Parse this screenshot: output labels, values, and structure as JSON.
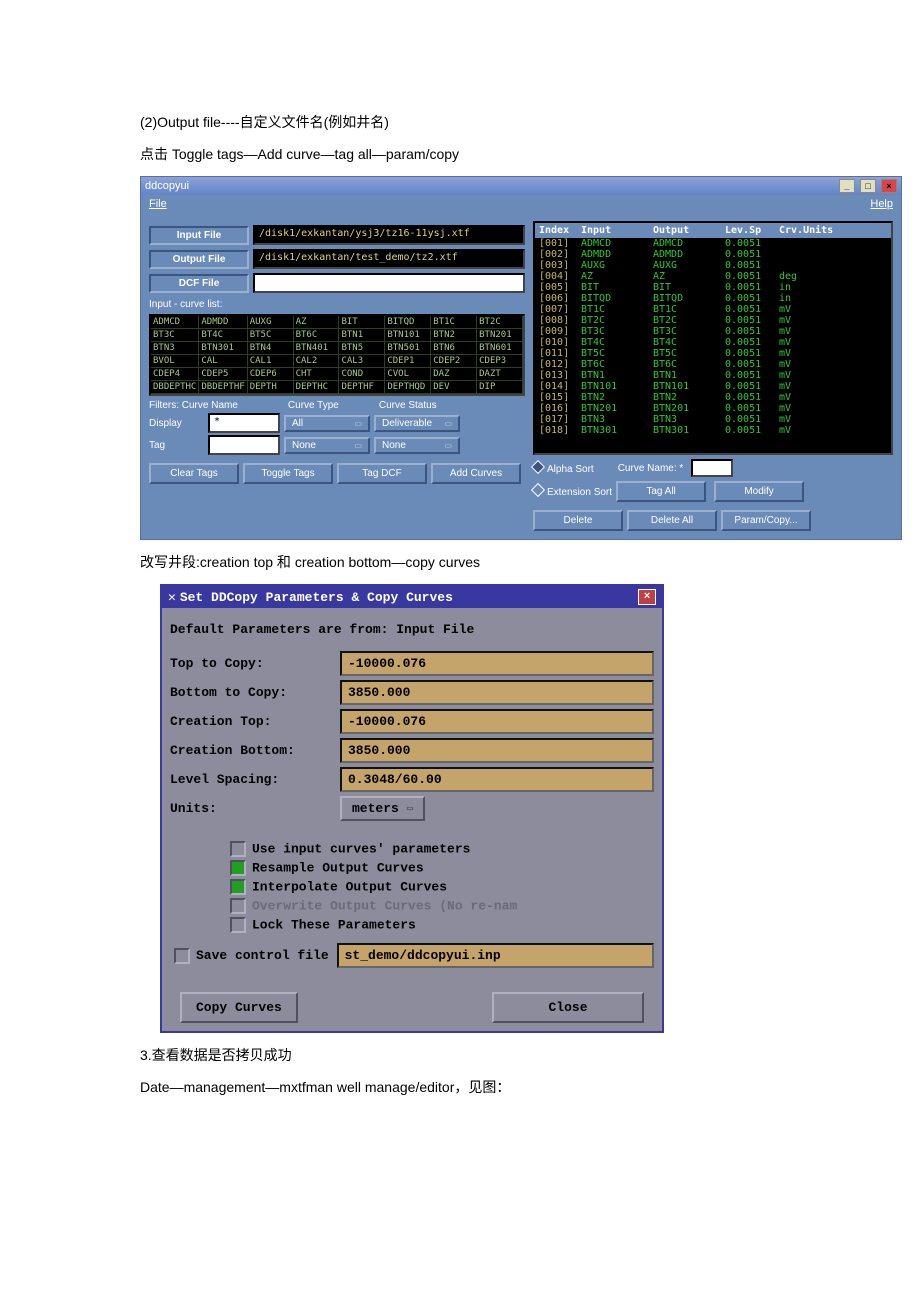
{
  "text": {
    "p1": "(2)Output file----自定义文件名(例如井名)",
    "p2": "点击 Toggle tags—Add curve—tag all—param/copy",
    "p3": "改写井段:creation top 和 creation bottom—copy curves",
    "p4": "3.查看数据是否拷贝成功",
    "p5": "Date—management—mxtfman well manage/editor，见图："
  },
  "win1": {
    "title": "ddcopyui",
    "menu": {
      "file": "File",
      "help": "Help"
    },
    "labels": {
      "input_file": "Input File",
      "output_file": "Output File",
      "dcf_file": "DCF File",
      "curve_list": "Input - curve list:",
      "filters": "Filters: Curve Name",
      "curve_type": "Curve Type",
      "curve_status": "Curve Status",
      "display": "Display",
      "tag": "Tag",
      "display_val": "*",
      "all": "All",
      "none": "None",
      "deliverable": "Deliverable"
    },
    "fields": {
      "input": "/disk1/exkantan/ysj3/tz16-11ysj.xtf",
      "output": "/disk1/exkantan/test_demo/tz2.xtf",
      "dcf": ""
    },
    "grid": [
      "ADMCD",
      "ADMDD",
      "AUXG",
      "AZ",
      "BIT",
      "BITQD",
      "BT1C",
      "BT2C",
      "BT3C",
      "BT4C",
      "BT5C",
      "BT6C",
      "BTN1",
      "BTN101",
      "BTN2",
      "BTN201",
      "BTN3",
      "BTN301",
      "BTN4",
      "BTN401",
      "BTN5",
      "BTN501",
      "BTN6",
      "BTN601",
      "BVOL",
      "CAL",
      "CAL1",
      "CAL2",
      "CAL3",
      "CDEP1",
      "CDEP2",
      "CDEP3",
      "CDEP4",
      "CDEP5",
      "CDEP6",
      "CHT",
      "COND",
      "CVOL",
      "DAZ",
      "DAZT",
      "DBDEPTHC",
      "DBDEPTHF",
      "DEPTH",
      "DEPTHC",
      "DEPTHF",
      "DEPTHQD",
      "DEV",
      "DIP"
    ],
    "buttons": {
      "clear": "Clear Tags",
      "toggle": "Toggle Tags",
      "tagdcf": "Tag DCF",
      "add": "Add Curves",
      "delete": "Delete",
      "deleteall": "Delete All",
      "param": "Param/Copy...",
      "tagall": "Tag All",
      "modify": "Modify"
    },
    "rheader": {
      "idx": "Index",
      "in": "Input",
      "out": "Output",
      "lev": "Lev.Sp",
      "units": "Crv.Units"
    },
    "rrows": [
      {
        "i": "[001]",
        "n": "ADMCD",
        "o": "ADMCD",
        "l": "0.0051",
        "u": ""
      },
      {
        "i": "[002]",
        "n": "ADMDD",
        "o": "ADMDD",
        "l": "0.0051",
        "u": ""
      },
      {
        "i": "[003]",
        "n": "AUXG",
        "o": "AUXG",
        "l": "0.0051",
        "u": ""
      },
      {
        "i": "[004]",
        "n": "AZ",
        "o": "AZ",
        "l": "0.0051",
        "u": "deg"
      },
      {
        "i": "[005]",
        "n": "BIT",
        "o": "BIT",
        "l": "0.0051",
        "u": "in"
      },
      {
        "i": "[006]",
        "n": "BITQD",
        "o": "BITQD",
        "l": "0.0051",
        "u": "in"
      },
      {
        "i": "[007]",
        "n": "BT1C",
        "o": "BT1C",
        "l": "0.0051",
        "u": "mV"
      },
      {
        "i": "[008]",
        "n": "BT2C",
        "o": "BT2C",
        "l": "0.0051",
        "u": "mV"
      },
      {
        "i": "[009]",
        "n": "BT3C",
        "o": "BT3C",
        "l": "0.0051",
        "u": "mV"
      },
      {
        "i": "[010]",
        "n": "BT4C",
        "o": "BT4C",
        "l": "0.0051",
        "u": "mV"
      },
      {
        "i": "[011]",
        "n": "BT5C",
        "o": "BT5C",
        "l": "0.0051",
        "u": "mV"
      },
      {
        "i": "[012]",
        "n": "BT6C",
        "o": "BT6C",
        "l": "0.0051",
        "u": "mV"
      },
      {
        "i": "[013]",
        "n": "BTN1",
        "o": "BTN1",
        "l": "0.0051",
        "u": "mV"
      },
      {
        "i": "[014]",
        "n": "BTN101",
        "o": "BTN101",
        "l": "0.0051",
        "u": "mV"
      },
      {
        "i": "[015]",
        "n": "BTN2",
        "o": "BTN2",
        "l": "0.0051",
        "u": "mV"
      },
      {
        "i": "[016]",
        "n": "BTN201",
        "o": "BTN201",
        "l": "0.0051",
        "u": "mV"
      },
      {
        "i": "[017]",
        "n": "BTN3",
        "o": "BTN3",
        "l": "0.0051",
        "u": "mV"
      },
      {
        "i": "[018]",
        "n": "BTN301",
        "o": "BTN301",
        "l": "0.0051",
        "u": "mV"
      }
    ],
    "sort": {
      "alpha": "Alpha Sort",
      "ext": "Extension Sort",
      "cname": "Curve Name: *"
    }
  },
  "win2": {
    "title": "Set DDCopy Parameters & Copy Curves",
    "header": "Default Parameters are from: Input  File",
    "labels": {
      "top": "Top to Copy:",
      "bottom": "Bottom to Copy:",
      "ctop": "Creation Top:",
      "cbottom": "Creation Bottom:",
      "spacing": "Level Spacing:",
      "units": "Units:",
      "meters": "meters"
    },
    "fields": {
      "top": "-10000.076",
      "bottom": "3850.000",
      "ctop": "-10000.076",
      "cbottom": "3850.000",
      "spacing": "0.3048/60.00"
    },
    "checks": {
      "c1": "Use input curves' parameters",
      "c2": "Resample Output Curves",
      "c3": "Interpolate Output Curves",
      "c4": "Overwrite Output Curves (No re-nam",
      "c5": "Lock These Parameters",
      "save": "Save control file",
      "savefile": "st_demo/ddcopyui.inp"
    },
    "buttons": {
      "copy": "Copy Curves",
      "close": "Close"
    }
  }
}
